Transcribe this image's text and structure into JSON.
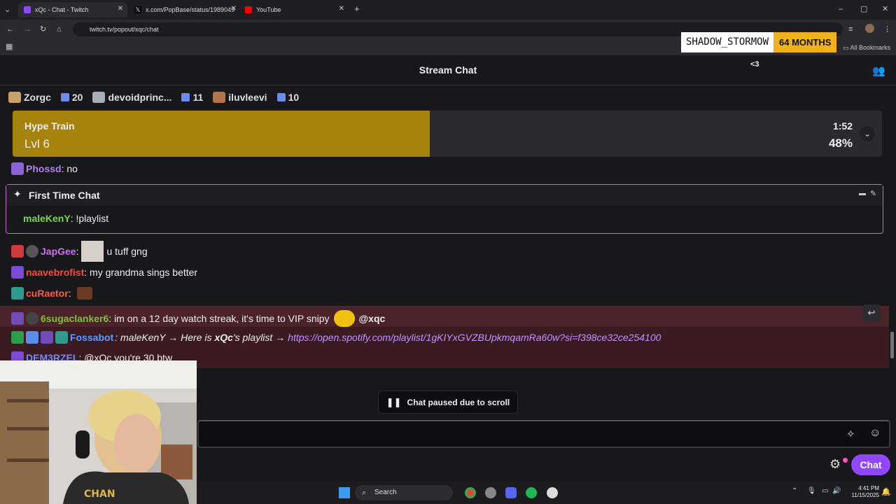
{
  "browser": {
    "tabs": [
      {
        "title": "xQc - Chat - Twitch",
        "active": true
      },
      {
        "title": "x.com/PopBase/status/1989049"
      },
      {
        "title": "YouTube"
      }
    ],
    "url": "twitch.tv/popout/xqc/chat",
    "bookmarks_label": "All Bookmarks"
  },
  "sub_alert": {
    "name": "SHADOW_STORMOW",
    "months": "64 MONTHS"
  },
  "chat": {
    "title": "Stream Chat",
    "heart": "<3",
    "leaderboard": [
      {
        "name": "Zorgc",
        "count": "20"
      },
      {
        "name": "devoidprinc...",
        "count": "11"
      },
      {
        "name": "iluvleevi",
        "count": "10"
      }
    ],
    "hype_train": {
      "title": "Hype Train",
      "level": "Lvl 6",
      "timer": "1:52",
      "percent": "48%",
      "progress": 0.48
    },
    "messages": {
      "m1": {
        "user": "Phossd",
        "text": ": no",
        "color": "#b37ef2"
      },
      "ftc_title": "First Time Chat",
      "m2": {
        "user": "maleKenY",
        "text": ": !playlist",
        "color": "#7fd35a"
      },
      "m3": {
        "user": "JapGee",
        "sep": ":",
        "text": "u tuff gng",
        "color": "#d06df2"
      },
      "m4": {
        "user": "naavebrofist",
        "text": ": my grandma sings better",
        "color": "#f44b3b"
      },
      "m5": {
        "user": "cuRaetor",
        "text": ":",
        "color": "#ff5a3d"
      },
      "m6": {
        "user": "6sugaclanker6",
        "text": ": im on a 12 day watch streak, it's time to VIP snipy",
        "mention": "@xqc",
        "color": "#7fbf3a"
      },
      "m7": {
        "user": "Fossabot",
        "pre": ": maleKenY → Here is",
        "bold": "xQc",
        "mid": "'s playlist →",
        "link": "https://open.spotify.com/playlist/1gKIYxGVZBUpkmqamRa60w?si=f398ce32ce254100",
        "color": "#5c9cff"
      },
      "m8": {
        "user": "DEM3RZEL",
        "text": ": @xQc you're 30 btw",
        "color": "#6c8cff"
      }
    },
    "paused": "Chat paused due to scroll",
    "chat_button": "Chat"
  },
  "taskbar": {
    "search": "Search",
    "time": "4:41 PM",
    "date": "11/15/2025"
  }
}
